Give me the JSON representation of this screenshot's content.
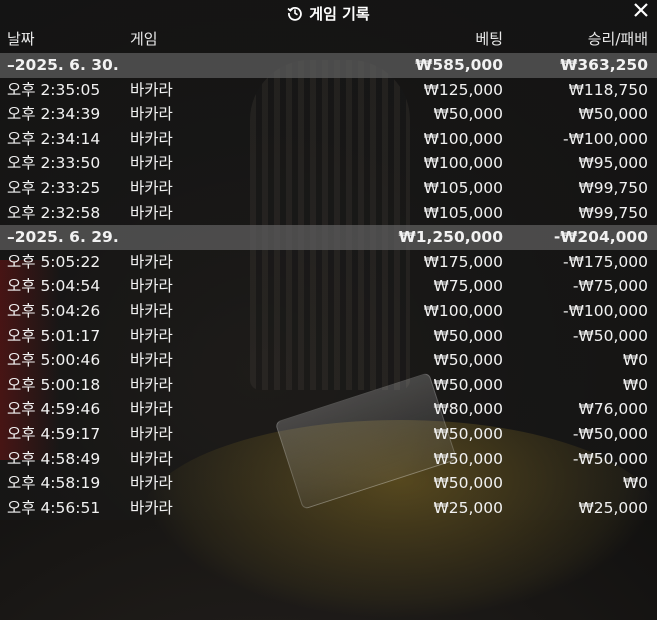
{
  "title": "게임 기록",
  "icons": {
    "title_icon": "history-icon",
    "close": "close-icon"
  },
  "columns": {
    "date": "날짜",
    "game": "게임",
    "bet": "베팅",
    "result": "승리/패배"
  },
  "groups": [
    {
      "date": "–2025. 6. 30.",
      "bet": "₩585,000",
      "result": "₩363,250",
      "rows": [
        {
          "time": "오후 2:35:05",
          "game": "바카라",
          "bet": "₩125,000",
          "result": "₩118,750"
        },
        {
          "time": "오후 2:34:39",
          "game": "바카라",
          "bet": "₩50,000",
          "result": "₩50,000"
        },
        {
          "time": "오후 2:34:14",
          "game": "바카라",
          "bet": "₩100,000",
          "result": "-₩100,000"
        },
        {
          "time": "오후 2:33:50",
          "game": "바카라",
          "bet": "₩100,000",
          "result": "₩95,000"
        },
        {
          "time": "오후 2:33:25",
          "game": "바카라",
          "bet": "₩105,000",
          "result": "₩99,750"
        },
        {
          "time": "오후 2:32:58",
          "game": "바카라",
          "bet": "₩105,000",
          "result": "₩99,750"
        }
      ]
    },
    {
      "date": "–2025. 6. 29.",
      "bet": "₩1,250,000",
      "result": "-₩204,000",
      "rows": [
        {
          "time": "오후 5:05:22",
          "game": "바카라",
          "bet": "₩175,000",
          "result": "-₩175,000"
        },
        {
          "time": "오후 5:04:54",
          "game": "바카라",
          "bet": "₩75,000",
          "result": "-₩75,000"
        },
        {
          "time": "오후 5:04:26",
          "game": "바카라",
          "bet": "₩100,000",
          "result": "-₩100,000"
        },
        {
          "time": "오후 5:01:17",
          "game": "바카라",
          "bet": "₩50,000",
          "result": "-₩50,000"
        },
        {
          "time": "오후 5:00:46",
          "game": "바카라",
          "bet": "₩50,000",
          "result": "₩0"
        },
        {
          "time": "오후 5:00:18",
          "game": "바카라",
          "bet": "₩50,000",
          "result": "₩0"
        },
        {
          "time": "오후 4:59:46",
          "game": "바카라",
          "bet": "₩80,000",
          "result": "₩76,000"
        },
        {
          "time": "오후 4:59:17",
          "game": "바카라",
          "bet": "₩50,000",
          "result": "-₩50,000"
        },
        {
          "time": "오후 4:58:49",
          "game": "바카라",
          "bet": "₩50,000",
          "result": "-₩50,000"
        },
        {
          "time": "오후 4:58:19",
          "game": "바카라",
          "bet": "₩50,000",
          "result": "₩0"
        },
        {
          "time": "오후 4:56:51",
          "game": "바카라",
          "bet": "₩25,000",
          "result": "₩25,000"
        }
      ]
    }
  ]
}
